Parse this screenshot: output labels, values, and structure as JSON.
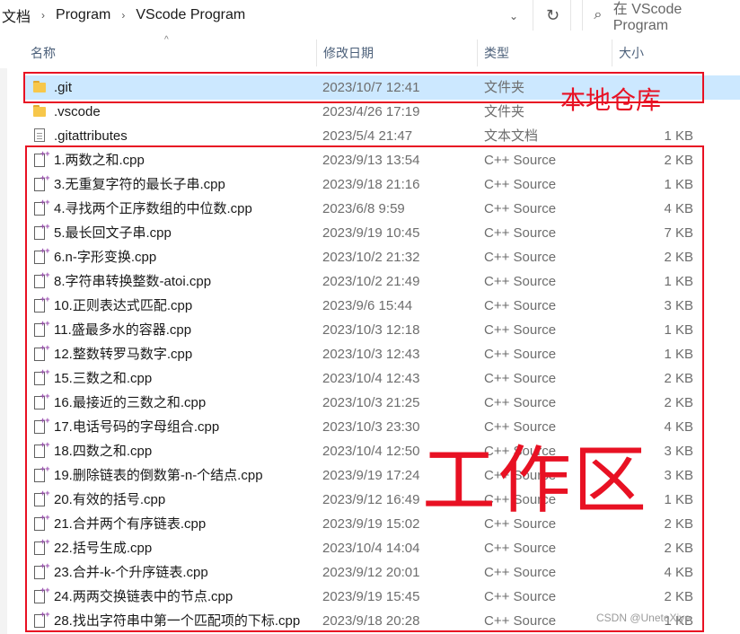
{
  "address_bar": {
    "breadcrumbs": [
      "文档",
      "Program",
      "VScode Program"
    ],
    "dropdown_icon": "chevron-down-icon",
    "refresh_icon": "refresh-icon"
  },
  "search": {
    "placeholder": "在 VScode Program",
    "icon": "search-icon"
  },
  "columns": {
    "name": "名称",
    "date": "修改日期",
    "type": "类型",
    "size": "大小"
  },
  "files": [
    {
      "name": ".git",
      "date": "2023/10/7 12:41",
      "type": "文件夹",
      "size": "",
      "icon": "folder-icon",
      "selected": true
    },
    {
      "name": ".vscode",
      "date": "2023/4/26 17:19",
      "type": "文件夹",
      "size": "",
      "icon": "folder-icon"
    },
    {
      "name": ".gitattributes",
      "date": "2023/5/4 21:47",
      "type": "文本文档",
      "size": "1 KB",
      "icon": "text-document-icon"
    },
    {
      "name": "1.两数之和.cpp",
      "date": "2023/9/13 13:54",
      "type": "C++ Source",
      "size": "2 KB",
      "icon": "cpp-file-icon"
    },
    {
      "name": "3.无重复字符的最长子串.cpp",
      "date": "2023/9/18 21:16",
      "type": "C++ Source",
      "size": "1 KB",
      "icon": "cpp-file-icon"
    },
    {
      "name": "4.寻找两个正序数组的中位数.cpp",
      "date": "2023/6/8 9:59",
      "type": "C++ Source",
      "size": "4 KB",
      "icon": "cpp-file-icon"
    },
    {
      "name": "5.最长回文子串.cpp",
      "date": "2023/9/19 10:45",
      "type": "C++ Source",
      "size": "7 KB",
      "icon": "cpp-file-icon"
    },
    {
      "name": "6.n-字形变换.cpp",
      "date": "2023/10/2 21:32",
      "type": "C++ Source",
      "size": "2 KB",
      "icon": "cpp-file-icon"
    },
    {
      "name": "8.字符串转换整数-atoi.cpp",
      "date": "2023/10/2 21:49",
      "type": "C++ Source",
      "size": "1 KB",
      "icon": "cpp-file-icon"
    },
    {
      "name": "10.正则表达式匹配.cpp",
      "date": "2023/9/6 15:44",
      "type": "C++ Source",
      "size": "3 KB",
      "icon": "cpp-file-icon"
    },
    {
      "name": "11.盛最多水的容器.cpp",
      "date": "2023/10/3 12:18",
      "type": "C++ Source",
      "size": "1 KB",
      "icon": "cpp-file-icon"
    },
    {
      "name": "12.整数转罗马数字.cpp",
      "date": "2023/10/3 12:43",
      "type": "C++ Source",
      "size": "1 KB",
      "icon": "cpp-file-icon"
    },
    {
      "name": "15.三数之和.cpp",
      "date": "2023/10/4 12:43",
      "type": "C++ Source",
      "size": "2 KB",
      "icon": "cpp-file-icon"
    },
    {
      "name": "16.最接近的三数之和.cpp",
      "date": "2023/10/3 21:25",
      "type": "C++ Source",
      "size": "2 KB",
      "icon": "cpp-file-icon"
    },
    {
      "name": "17.电话号码的字母组合.cpp",
      "date": "2023/10/3 23:30",
      "type": "C++ Source",
      "size": "4 KB",
      "icon": "cpp-file-icon"
    },
    {
      "name": "18.四数之和.cpp",
      "date": "2023/10/4 12:50",
      "type": "C++ Source",
      "size": "3 KB",
      "icon": "cpp-file-icon"
    },
    {
      "name": "19.删除链表的倒数第-n-个结点.cpp",
      "date": "2023/9/19 17:24",
      "type": "C++ Source",
      "size": "3 KB",
      "icon": "cpp-file-icon"
    },
    {
      "name": "20.有效的括号.cpp",
      "date": "2023/9/12 16:49",
      "type": "C++ Source",
      "size": "1 KB",
      "icon": "cpp-file-icon"
    },
    {
      "name": "21.合并两个有序链表.cpp",
      "date": "2023/9/19 15:02",
      "type": "C++ Source",
      "size": "2 KB",
      "icon": "cpp-file-icon"
    },
    {
      "name": "22.括号生成.cpp",
      "date": "2023/10/4 14:04",
      "type": "C++ Source",
      "size": "2 KB",
      "icon": "cpp-file-icon"
    },
    {
      "name": "23.合并-k-个升序链表.cpp",
      "date": "2023/9/12 20:01",
      "type": "C++ Source",
      "size": "4 KB",
      "icon": "cpp-file-icon"
    },
    {
      "name": "24.两两交换链表中的节点.cpp",
      "date": "2023/9/19 15:45",
      "type": "C++ Source",
      "size": "2 KB",
      "icon": "cpp-file-icon"
    },
    {
      "name": "28.找出字符串中第一个匹配项的下标.cpp",
      "date": "2023/9/18 20:28",
      "type": "C++ Source",
      "size": "1 KB",
      "icon": "cpp-file-icon"
    }
  ],
  "annotations": {
    "local_repo": "本地仓库",
    "workspace": "工作区",
    "color": "#e81123"
  },
  "watermark": "CSDN @UnetoXiye"
}
